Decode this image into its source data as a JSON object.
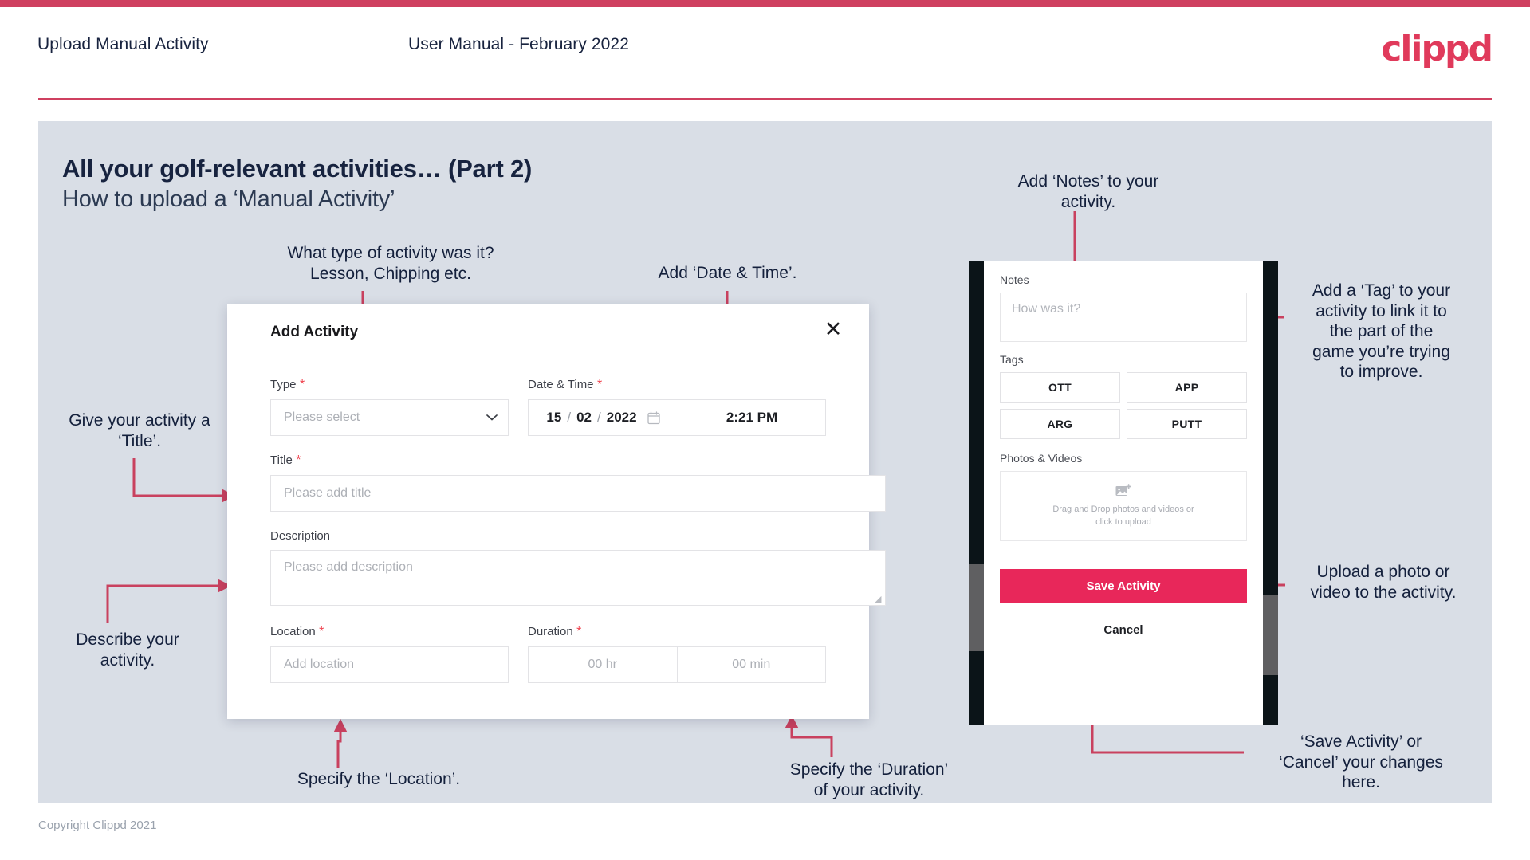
{
  "header": {
    "title": "Upload Manual Activity",
    "subtitle": "User Manual - February 2022",
    "logo": "clippd"
  },
  "slide": {
    "title": "All your golf-relevant activities… (Part 2)",
    "subtitle": "How to upload a ‘Manual Activity’",
    "copyright": "Copyright Clippd 2021"
  },
  "annotations": {
    "type": "What type of activity was it?\nLesson, Chipping etc.",
    "date_time": "Add ‘Date & Time’.",
    "title": "Give your activity a\n‘Title’.",
    "description": "Describe your\nactivity.",
    "location": "Specify the ‘Location’.",
    "duration": "Specify the ‘Duration’\nof your activity.",
    "notes": "Add ‘Notes’ to your\nactivity.",
    "tags": "Add a ‘Tag’ to your\nactivity to link it to\nthe part of the\ngame you’re trying\nto improve.",
    "photos": "Upload a photo or\nvideo to the activity.",
    "save_cancel": "‘Save Activity’ or\n‘Cancel’ your changes\nhere."
  },
  "dialog": {
    "title": "Add Activity",
    "close_icon": "close-icon",
    "fields": {
      "type": {
        "label": "Type",
        "required": true,
        "placeholder": "Please select",
        "value": ""
      },
      "date_time": {
        "label": "Date & Time",
        "required": true,
        "day": "15",
        "month": "02",
        "year": "2022",
        "separator": "/",
        "time": "2:21 PM",
        "calendar_icon": "calendar-icon"
      },
      "title": {
        "label": "Title",
        "required": true,
        "placeholder": "Please add title",
        "value": ""
      },
      "description": {
        "label": "Description",
        "required": false,
        "placeholder": "Please add description",
        "value": ""
      },
      "location": {
        "label": "Location",
        "required": true,
        "placeholder": "Add location",
        "value": ""
      },
      "duration": {
        "label": "Duration",
        "required": true,
        "hours_placeholder": "00 hr",
        "minutes_placeholder": "00 min"
      }
    }
  },
  "phone": {
    "notes": {
      "label": "Notes",
      "placeholder": "How was it?",
      "value": ""
    },
    "tags": {
      "label": "Tags",
      "items": [
        "OTT",
        "APP",
        "ARG",
        "PUTT"
      ]
    },
    "photos": {
      "label": "Photos & Videos",
      "dropzone_icon": "add-image-icon",
      "dropzone_line1": "Drag and Drop photos and videos or",
      "dropzone_line2": "click to upload"
    },
    "save_label": "Save Activity",
    "cancel_label": "Cancel"
  },
  "colors": {
    "brand": "#e8275a",
    "top_bar": "#cf4060",
    "slide_bg": "#d9dee6",
    "annotation_arrow": "#c9415f",
    "required": "#ef3e4a",
    "title_text": "#17233f"
  }
}
